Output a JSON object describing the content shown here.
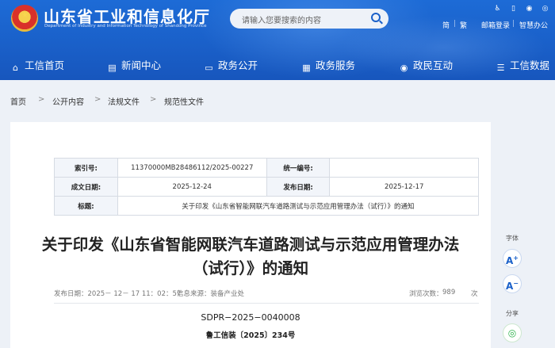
{
  "header": {
    "site_title": "山东省工业和信息化厅",
    "site_subtitle": "Department of Industry and Information Technology of Shandong Province",
    "search_placeholder": "请输入您要搜索的内容",
    "top_links": {
      "jian": "简",
      "fan": "繁",
      "mail_login": "邮箱登录",
      "smart_assistant": "智慧办公"
    },
    "nav": [
      {
        "label": "工信首页",
        "icon": "home-icon"
      },
      {
        "label": "新闻中心",
        "icon": "news-icon"
      },
      {
        "label": "政务公开",
        "icon": "monitor-icon"
      },
      {
        "label": "政务服务",
        "icon": "grid-icon"
      },
      {
        "label": "政民互动",
        "icon": "chat-icon"
      },
      {
        "label": "工信数据",
        "icon": "database-icon"
      }
    ],
    "accent": "#1a60c9"
  },
  "breadcrumb": [
    "首页",
    "公开内容",
    "法规文件",
    "规范性文件"
  ],
  "meta": {
    "index_label": "索引号:",
    "index_value": "11370000MB28486112/2025-00227",
    "code_label": "统一编号:",
    "code_value": "",
    "date_label": "成文日期:",
    "date_value": "2025-12-24",
    "pub_label": "发布日期:",
    "pub_value": "2025-12-17",
    "title_label": "标题:",
    "title_value": "关于印发《山东省智能网联汽车道路测试与示范应用管理办法（试行）》的通知"
  },
  "article": {
    "title": "关于印发《山东省智能网联汽车道路测试与示范应用管理办法（试行）》的通知",
    "published_time": "发布日期：2025－ 12－ 17 11：02：57",
    "source": "信息来源：装备产业处",
    "views_label": "浏览次数：",
    "views_count": "989",
    "views_unit": "次",
    "doc_number": "SDPR−2025−0040008",
    "doc_code": "鲁工信装〔2025〕234号"
  },
  "tools": {
    "font_label": "字体",
    "share_label": "分享"
  }
}
